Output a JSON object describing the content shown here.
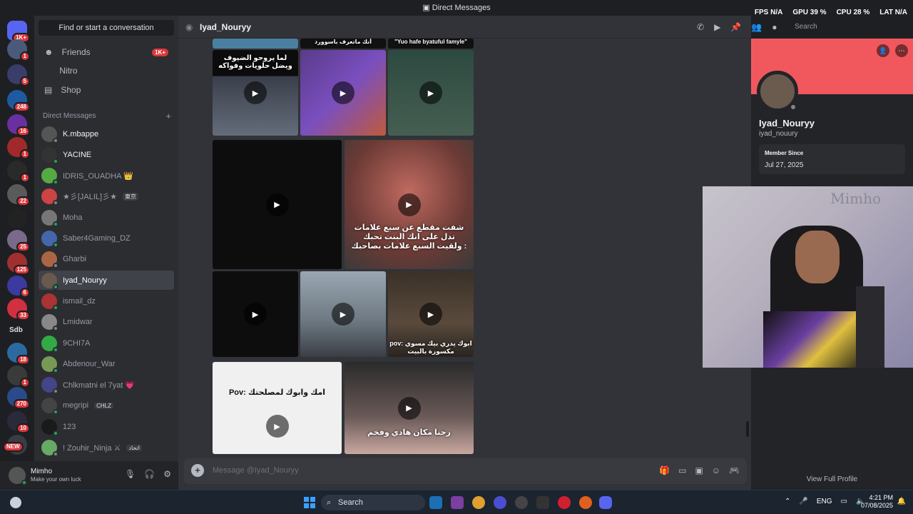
{
  "app": {
    "title": "Direct Messages"
  },
  "overlay": {
    "fps_label": "FPS",
    "fps": "N/A",
    "gpu_label": "GPU",
    "gpu": "39 %",
    "cpu_label": "CPU",
    "cpu": "28 %",
    "lat_label": "LAT",
    "lat": "N/A"
  },
  "guild_badges": [
    "1K+",
    "1",
    "5",
    "248",
    "16",
    "1",
    "1",
    "22",
    "",
    "25",
    "125",
    "6",
    "33",
    "Sdb",
    "18",
    "1",
    "270",
    "10",
    "NEW"
  ],
  "dm_sidebar": {
    "search_placeholder": "Find or start a conversation",
    "nav": [
      {
        "label": "Friends",
        "badge": "1K+"
      },
      {
        "label": "Nitro",
        "badge": ""
      },
      {
        "label": "Shop",
        "badge": ""
      }
    ],
    "header": "Direct Messages",
    "conversations": [
      {
        "name": "K.mbappe",
        "tag": ""
      },
      {
        "name": "YACINE",
        "tag": ""
      },
      {
        "name": "IDRIS_OUADHA 👑",
        "tag": ""
      },
      {
        "name": "★彡[JALIL]彡★",
        "tag": "東京"
      },
      {
        "name": "Moha",
        "tag": ""
      },
      {
        "name": "Saber4Gaming_DZ",
        "tag": ""
      },
      {
        "name": "Gharbi",
        "tag": ""
      },
      {
        "name": "Iyad_Nouryy",
        "tag": ""
      },
      {
        "name": "ismail_dz",
        "tag": ""
      },
      {
        "name": "Lmidwar",
        "tag": ""
      },
      {
        "name": "9CHI7A",
        "tag": ""
      },
      {
        "name": "Abdenour_War",
        "tag": ""
      },
      {
        "name": "Chlkmatni el 7yat 💗",
        "tag": ""
      },
      {
        "name": "megripi",
        "tag": "CHLZ"
      },
      {
        "name": "123",
        "tag": ""
      },
      {
        "name": "! Zouhir_Ninja ⚔",
        "tag": "اتحاد"
      }
    ]
  },
  "user": {
    "name": "Mimho",
    "status": "Make your own luck"
  },
  "channel": {
    "name": "Iyad_Nouryy",
    "message_placeholder": "Message @Iyad_Nouryy",
    "search_placeholder": "Search"
  },
  "media_captions": {
    "top1": "أنك ماتعرف باسوورد",
    "top2": "\"Yuo hafe byatuful famyle\"",
    "m1": "لما يروحو الضيوف ويضل حلويات وفواكه",
    "m2": "شفت مقطع عن سبع علامات تدل على انك البنت تحبك ولقيت السبع علامات بصاحبك :",
    "m3": "pov: ابوك يدري بيك مسوي مكسورة بالبيت",
    "m4": "Pov: امك وابوك لمصلحتك",
    "m5": "رحنا مكان هادي وفخم"
  },
  "profile": {
    "display_name": "Iyad_Nouryy",
    "username": "iyad_nouury",
    "member_since_label": "Member Since",
    "member_since": "Jul 27, 2025",
    "view_full_profile": "View Full Profile"
  },
  "webcam": {
    "watermark": "Mimho"
  },
  "taskbar": {
    "search": "Search",
    "lang": "ENG",
    "time": "4:21 PM",
    "date": "07/08/2025"
  }
}
